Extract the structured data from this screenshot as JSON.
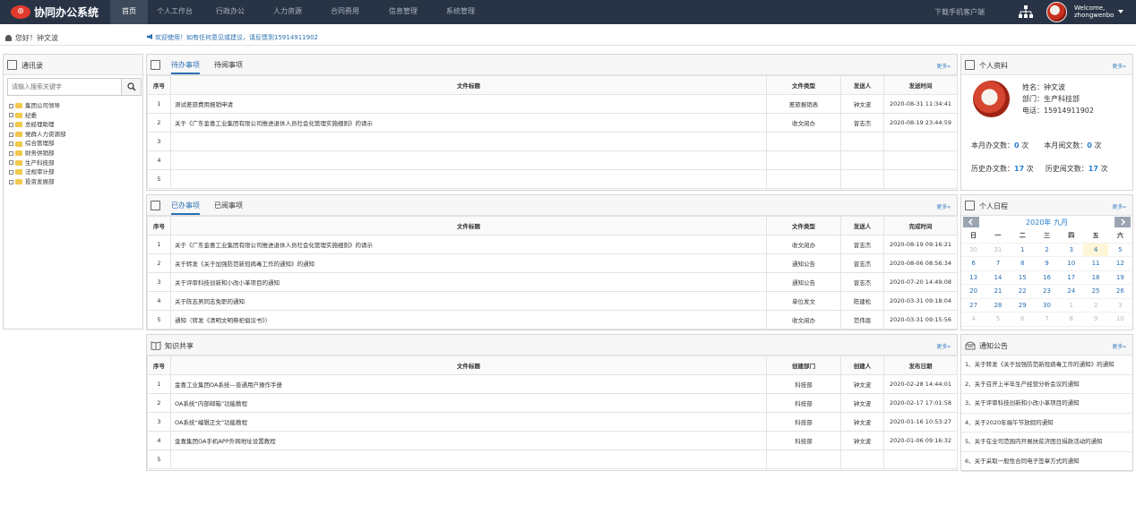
{
  "app": {
    "logo_mark": "⊙",
    "title": "协同办公系统"
  },
  "nav": [
    "首页",
    "个人工作台",
    "行政办公",
    "人力资源",
    "合同费用",
    "信息管理",
    "系统管理"
  ],
  "topbar": {
    "download": "下载手机客户端",
    "welcome": "Welcome,",
    "username": "zhongwenbo"
  },
  "subbar": {
    "hello": "您好！钟文波",
    "notice": "欢迎使用！如有任何意见或建议，请反馈到15914911902"
  },
  "contacts": {
    "title": "通讯录",
    "search_placeholder": "请输入搜索关键字",
    "tree": [
      "集团公司领导",
      "纪委",
      "总经理助理",
      "党群人力资源部",
      "综合管理部",
      "财务供销部",
      "生产科技部",
      "法规审计部",
      "投资发展部"
    ]
  },
  "todo": {
    "tabs": [
      "待办事项",
      "待阅事项"
    ],
    "more": "更多»",
    "columns": [
      "序号",
      "文件标题",
      "文件类型",
      "发送人",
      "发送时间"
    ],
    "rows": [
      [
        "1",
        "测试差旅费用报销申请",
        "差旅报销表",
        "钟文波",
        "2020-08-31 11:34:41"
      ],
      [
        "2",
        "关于《广东金喜工业集团有限公司推进退休人员社会化管理实施细则》的请示",
        "收文阅办",
        "曾志杰",
        "2020-08-19 23:44:59"
      ],
      [
        "3",
        "",
        "",
        "",
        ""
      ],
      [
        "4",
        "",
        "",
        "",
        ""
      ],
      [
        "5",
        "",
        "",
        "",
        ""
      ]
    ]
  },
  "done": {
    "tabs": [
      "已办事项",
      "已阅事项"
    ],
    "more": "更多»",
    "columns": [
      "序号",
      "文件标题",
      "文件类型",
      "发送人",
      "完成时间"
    ],
    "rows": [
      [
        "1",
        "关于《广东金喜工业集团有限公司推进退休人员社会化管理实施细则》的请示",
        "收文阅办",
        "曾志杰",
        "2020-08-19 09:16:21"
      ],
      [
        "2",
        "关于转发《关于加强防范新冠病毒工作的通知》的通知",
        "通知公告",
        "曾志杰",
        "2020-08-06 08:56:34"
      ],
      [
        "3",
        "关于评审科技创新和小改小革项目的通知",
        "通知公告",
        "曾志杰",
        "2020-07-20 14:49:08"
      ],
      [
        "4",
        "关于陈志男同志免职的通知",
        "单位发文",
        "陈建松",
        "2020-03-31 09:18:04"
      ],
      [
        "5",
        "通知（转发《清明文明祭祀倡议书》）",
        "收文阅办",
        "范伟恩",
        "2020-03-31 09:15:56"
      ]
    ]
  },
  "knowledge": {
    "title": "知识共享",
    "more": "更多»",
    "columns": [
      "序号",
      "文件标题",
      "创建部门",
      "创建人",
      "发布日期"
    ],
    "rows": [
      [
        "1",
        "金喜工业集团OA系统—普通用户操作手册",
        "科技部",
        "钟文波",
        "2020-02-28 14:44:01"
      ],
      [
        "2",
        "OA系统“内部邮箱”功能教程",
        "科技部",
        "钟文波",
        "2020-02-17 17:01:58"
      ],
      [
        "3",
        "OA系统“编辑正文”功能教程",
        "科技部",
        "钟文波",
        "2020-01-16 10:53:27"
      ],
      [
        "4",
        "金喜集团OA手机APP外网地址设置教程",
        "科技部",
        "钟文波",
        "2020-01-06 09:16:32"
      ],
      [
        "5",
        "",
        "",
        "",
        ""
      ]
    ]
  },
  "profile": {
    "title": "个人资料",
    "more": "更多»",
    "name": "姓名：钟文波",
    "dept": "部门：生产科技部",
    "phone": "电话：15914911902",
    "stats": [
      {
        "label": "本月办文数：",
        "value": "0",
        "unit": " 次"
      },
      {
        "label": "本月阅文数：",
        "value": "0",
        "unit": " 次"
      },
      {
        "label": "历史办文数：",
        "value": "17",
        "unit": " 次"
      },
      {
        "label": "历史阅文数：",
        "value": "17",
        "unit": " 次"
      }
    ]
  },
  "calendar": {
    "title": "个人日程",
    "more": "更多»",
    "month": "2020年 九月",
    "weekdays": [
      "日",
      "一",
      "二",
      "三",
      "四",
      "五",
      "六"
    ],
    "weeks": [
      [
        "30",
        "31",
        "1",
        "2",
        "3",
        "4",
        "5"
      ],
      [
        "6",
        "7",
        "8",
        "9",
        "10",
        "11",
        "12"
      ],
      [
        "13",
        "14",
        "15",
        "16",
        "17",
        "18",
        "19"
      ],
      [
        "20",
        "21",
        "22",
        "23",
        "24",
        "25",
        "26"
      ],
      [
        "27",
        "28",
        "29",
        "30",
        "1",
        "2",
        "3"
      ],
      [
        "4",
        "5",
        "6",
        "7",
        "8",
        "9",
        "10"
      ]
    ]
  },
  "announcements": {
    "title": "通知公告",
    "more": "更多»",
    "items": [
      "1、关于转发《关于加强防范新冠病毒工作的通知》的通知",
      "2、关于召开上半年生产经营分析会议的通知",
      "3、关于评审科技创新和小改小革项目的通知",
      "4、关于2020年端午节放假的通知",
      "5、关于在全司范围内开展扶贫济困日捐款活动的通知",
      "6、关于采取一般性合同电子签章方式的通知"
    ]
  }
}
